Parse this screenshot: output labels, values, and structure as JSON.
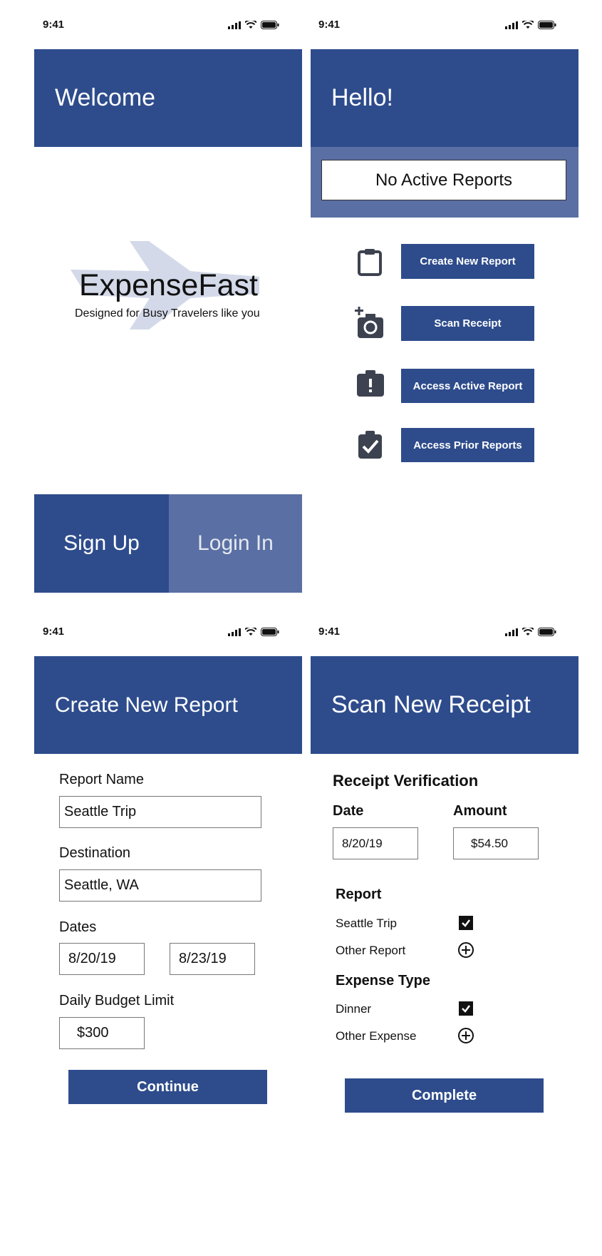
{
  "screen_welcome": {
    "status": {
      "time": "9:41"
    },
    "header_title": "Welcome",
    "brand": {
      "name": "ExpenseFast",
      "tagline": "Designed for Busy Travelers like you"
    },
    "signup_label": "Sign Up",
    "login_label": "Login In"
  },
  "screen_home": {
    "status": {
      "time": "9:41"
    },
    "header_title": "Hello!",
    "reports_banner": "No Active Reports",
    "actions": [
      {
        "label": "Create New Report",
        "icon": "clipboard-icon"
      },
      {
        "label": "Scan Receipt",
        "icon": "camera-plus-icon"
      },
      {
        "label": "Access Active Report",
        "icon": "clipboard-alert-icon"
      },
      {
        "label": "Access Prior Reports",
        "icon": "clipboard-check-icon"
      }
    ]
  },
  "screen_create": {
    "status": {
      "time": "9:41"
    },
    "header_title": "Create New Report",
    "report_name_label": "Report Name",
    "report_name_value": "Seattle Trip",
    "destination_label": "Destination",
    "destination_value": "Seattle, WA",
    "dates_label": "Dates",
    "date_start": "8/20/19",
    "date_end": "8/23/19",
    "budget_label": "Daily Budget Limit",
    "budget_value": "$300",
    "continue_label": "Continue"
  },
  "screen_scan": {
    "status": {
      "time": "9:41"
    },
    "header_title": "Scan New Receipt",
    "section_title": "Receipt Verification",
    "date_label": "Date",
    "date_value": "8/20/19",
    "amount_label": "Amount",
    "amount_value": "$54.50",
    "report_label": "Report",
    "report_options": [
      {
        "label": "Seattle Trip",
        "state": "checked"
      },
      {
        "label": "Other Report",
        "state": "add"
      }
    ],
    "expense_label": "Expense Type",
    "expense_options": [
      {
        "label": "Dinner",
        "state": "checked"
      },
      {
        "label": "Other Expense",
        "state": "add"
      }
    ],
    "complete_label": "Complete"
  },
  "colors": {
    "primary": "#2e4c8c",
    "secondary": "#5a6fa3",
    "icon_dark": "#3d4250",
    "plane": "#d3d9e8"
  }
}
